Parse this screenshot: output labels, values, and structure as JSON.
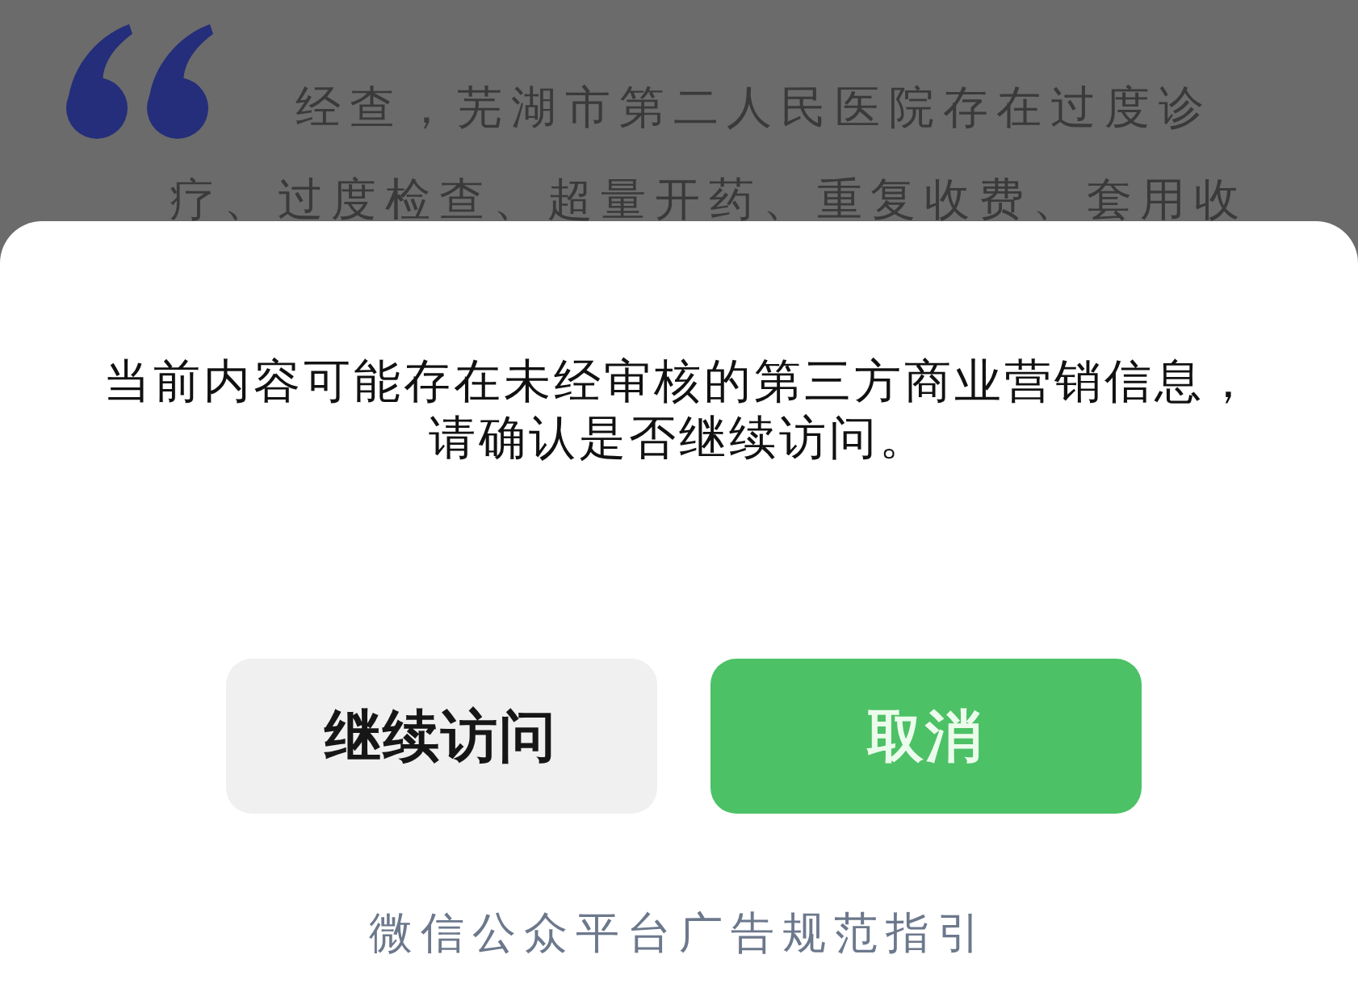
{
  "article": {
    "paragraph": "经查，芜湖市第二人民医院存在过度诊疗、过度检查、超量开药、重复收费、套用收"
  },
  "dialog": {
    "message": "当前内容可能存在未经审核的第三方商业营销信息，请确认是否继续访问。",
    "buttons": [
      {
        "label": "继续访问",
        "kind": "secondary"
      },
      {
        "label": "取消",
        "kind": "primary"
      }
    ],
    "footer_link": "微信公众平台广告规范指引"
  }
}
